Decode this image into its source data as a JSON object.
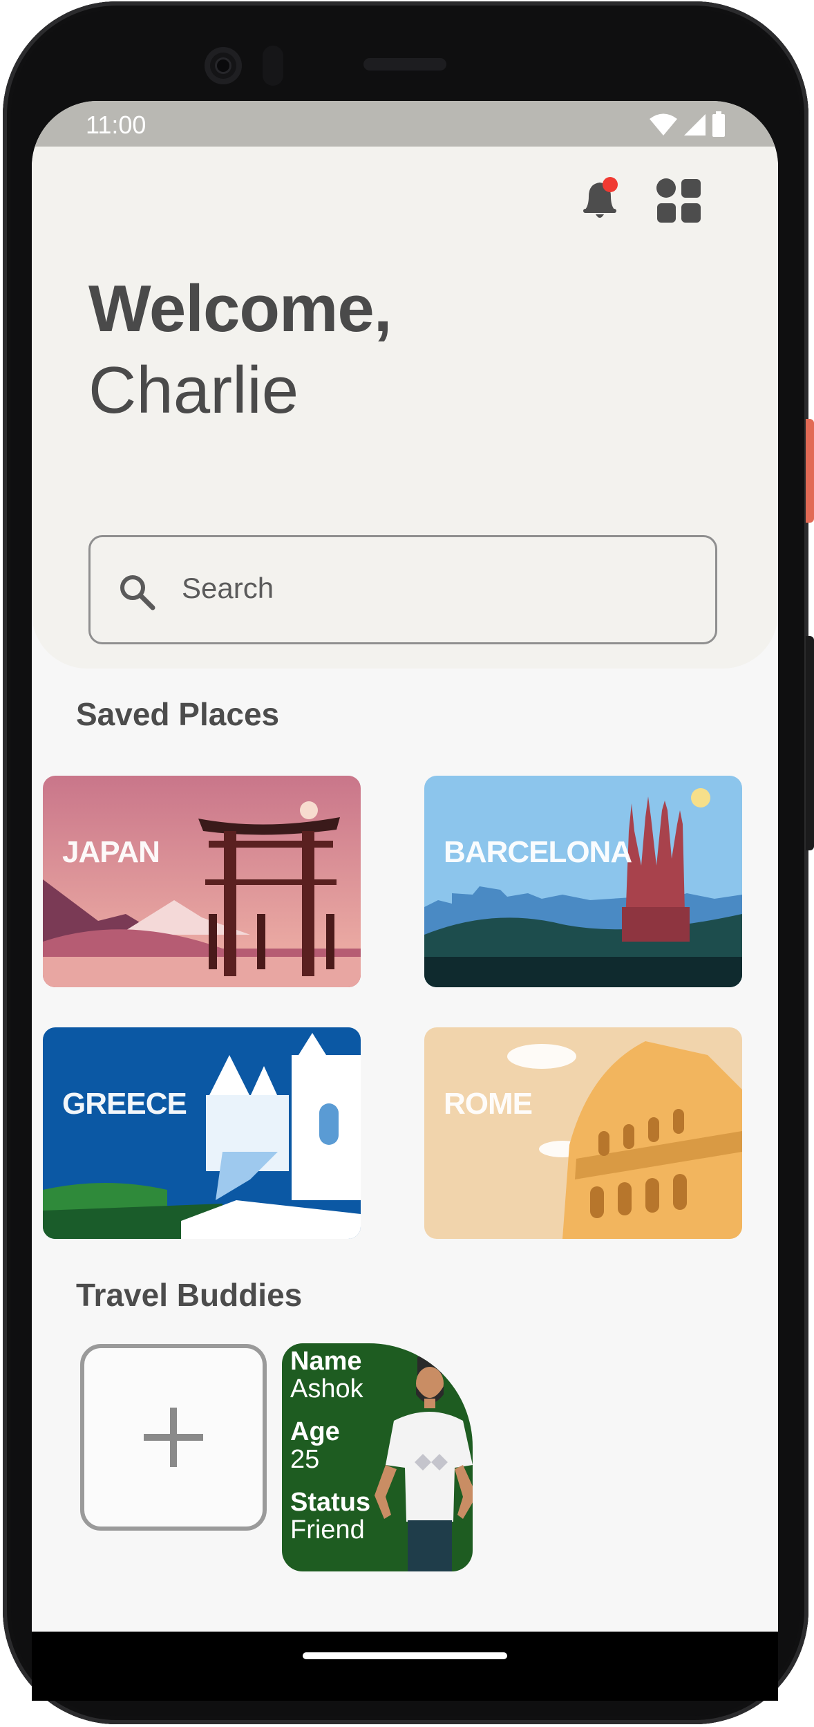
{
  "status_bar": {
    "time": "11:00"
  },
  "header": {
    "greeting": "Welcome,",
    "user_name": "Charlie",
    "notification_dot_color": "#f03a32"
  },
  "search": {
    "placeholder": "Search"
  },
  "saved_places": {
    "title": "Saved Places",
    "items": [
      {
        "label": "JAPAN"
      },
      {
        "label": "BARCELONA"
      },
      {
        "label": "GREECE"
      },
      {
        "label": "ROME"
      }
    ]
  },
  "travel_buddies": {
    "title": "Travel Buddies",
    "add_symbol": "+",
    "buddies": [
      {
        "name_label": "Name",
        "name": "Ashok",
        "age_label": "Age",
        "age": "25",
        "status_label": "Status",
        "status": "Friend"
      }
    ]
  },
  "colors": {
    "header_bg": "#f3f2ee",
    "buddy_card_bg": "#1e5c21",
    "text_primary": "#4a4a4a"
  }
}
